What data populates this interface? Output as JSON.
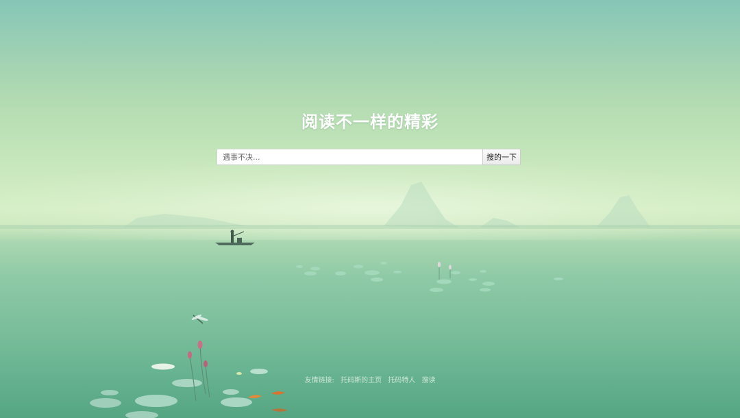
{
  "hero": {
    "title": "阅读不一样的精彩"
  },
  "search": {
    "placeholder": "遇事不决...",
    "value": "",
    "button_label": "搜的一下"
  },
  "footer": {
    "label": "友情链接:",
    "links": [
      {
        "label": "托码斯的主页"
      },
      {
        "label": "托码特人"
      },
      {
        "label": "搜读"
      }
    ]
  },
  "colors": {
    "sky_top": "#86c6b7",
    "horizon": "#d6efc7",
    "water_bottom": "#55a583",
    "title_text": "#ffffff"
  }
}
